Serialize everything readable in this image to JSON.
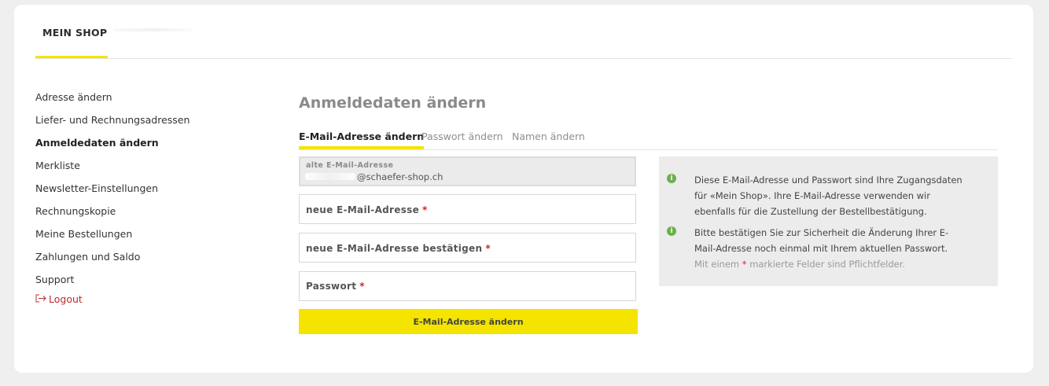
{
  "header": {
    "tab_label": "MEIN SHOP"
  },
  "sidebar": {
    "items": [
      {
        "label": "Adresse ändern"
      },
      {
        "label": "Liefer- und Rechnungsadressen"
      },
      {
        "label": "Anmeldedaten ändern",
        "active": true
      },
      {
        "label": "Merkliste"
      },
      {
        "label": "Newsletter-Einstellungen"
      },
      {
        "label": "Rechnungskopie"
      },
      {
        "label": "Meine Bestellungen"
      },
      {
        "label": "Zahlungen und Saldo"
      },
      {
        "label": "Support"
      }
    ],
    "logout": {
      "label": "Logout",
      "icon": "logout-icon",
      "color": "#c0282d"
    }
  },
  "main": {
    "title": "Anmeldedaten ändern",
    "tabs": [
      {
        "label": "E-Mail-Adresse ändern",
        "active": true
      },
      {
        "label": "Passwort ändern"
      },
      {
        "label": "Namen ändern"
      }
    ],
    "form": {
      "old_email_label": "alte E-Mail-Adresse",
      "old_email_value": "@schaefer-shop.ch",
      "new_email_label": "neue E-Mail-Adresse",
      "confirm_email_label": "neue E-Mail-Adresse bestätigen",
      "password_label": "Passwort",
      "required_mark": "*",
      "submit_label": "E-Mail-Adresse ändern"
    },
    "info": {
      "paragraph1": "Diese E-Mail-Adresse und Passwort sind Ihre Zugangsdaten für «Mein Shop». Ihre E-Mail-Adresse verwenden wir ebenfalls für die Zustellung der Bestellbestätigung.",
      "paragraph2": "Bitte bestätigen Sie zur Sicherheit die Änderung Ihrer E-Mail-Adresse noch einmal mit Ihrem aktuellen Passwort.",
      "note_prefix": "Mit einem",
      "note_star": "*",
      "note_suffix": "markierte Felder sind Pflichtfelder.",
      "icon": "info-icon"
    }
  },
  "colors": {
    "accent": "#f5e400",
    "required": "#d2232a",
    "info_icon": "#6ab04c"
  }
}
